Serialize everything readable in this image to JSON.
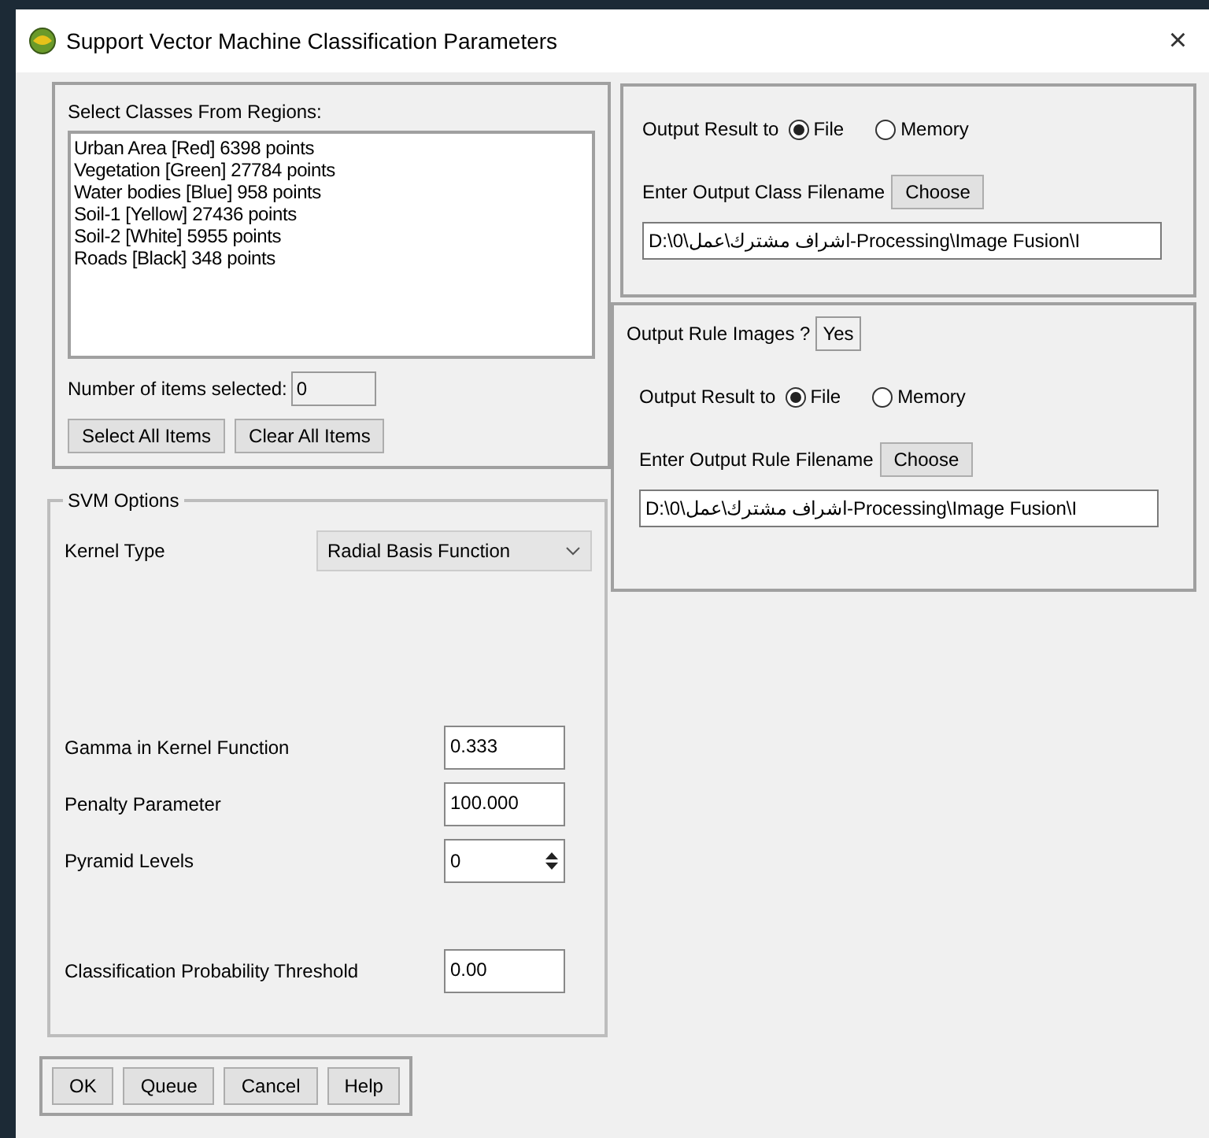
{
  "window": {
    "title": "Support Vector Machine Classification Parameters",
    "close": "×"
  },
  "classes": {
    "label": "Select Classes From Regions:",
    "items": [
      {
        "text": "Urban Area [Red] 6398 points",
        "selected": false
      },
      {
        "text": "Vegetation [Green] 27784 points",
        "selected": false
      },
      {
        "text": "Water bodies [Blue] 958 points",
        "selected": false
      },
      {
        "text": "Soil-1 [Yellow] 27436 points",
        "selected": false
      },
      {
        "text": "Soil-2 [White] 5955 points",
        "selected": false
      },
      {
        "text": "Roads [Black] 348 points",
        "selected": false
      }
    ],
    "count_label": "Number of items selected:",
    "count": "0",
    "buttons": [
      "Select All Items",
      "Clear All Items"
    ]
  },
  "svm_options": {
    "title": "SVM Options",
    "kernel": {
      "label": "Kernel Type",
      "value": "Radial Basis Function"
    },
    "params": [
      {
        "kind": "field",
        "label": "Gamma in Kernel Function",
        "value": "0.333"
      },
      {
        "kind": "field",
        "label": "Penalty Parameter",
        "value": "100.000"
      },
      {
        "kind": "spinner",
        "label": "Pyramid Levels",
        "value": "0"
      },
      {
        "kind": "field",
        "label": "Classification Probability Threshold",
        "value": "0.00"
      }
    ]
  },
  "class_output": {
    "label": "Output Result to",
    "options": [
      {
        "label": "File",
        "selected": true
      },
      {
        "label": "Memory",
        "selected": false
      }
    ],
    "filename_label": "Enter Output Class Filename",
    "choose": "Choose",
    "path": "D:\\0\\اشراف مشترك\\عمل-Processing\\Image Fusion\\I"
  },
  "rule_output": {
    "toggle_label": "Output Rule Images ?",
    "toggle": "Yes",
    "label": "Output Result to",
    "options": [
      {
        "label": "File",
        "selected": true
      },
      {
        "label": "Memory",
        "selected": false
      }
    ],
    "filename_label": "Enter Output Rule Filename",
    "choose": "Choose",
    "path": "D:\\0\\اشراف مشترك\\عمل-Processing\\Image Fusion\\I"
  },
  "buttons": [
    "OK",
    "Queue",
    "Cancel",
    "Help"
  ]
}
